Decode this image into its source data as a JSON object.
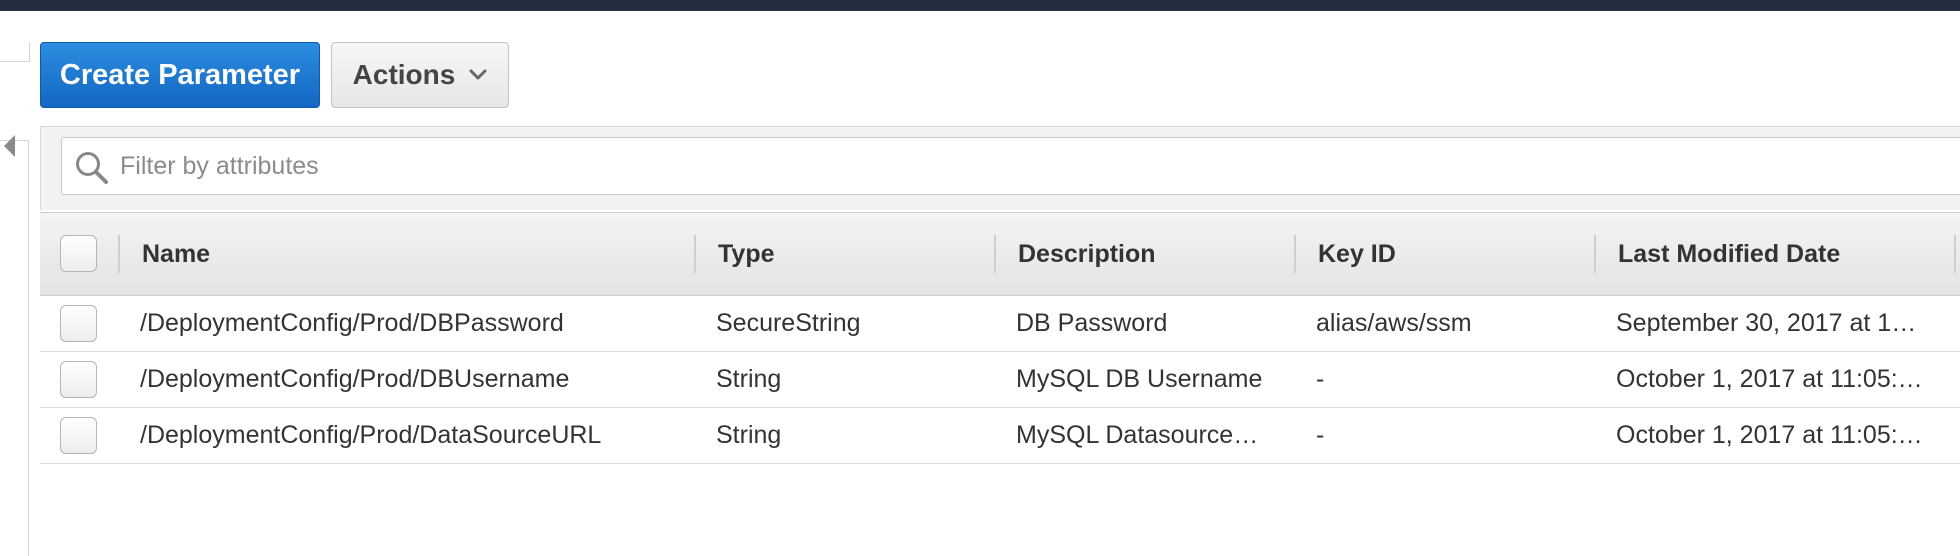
{
  "toolbar": {
    "create_label": "Create Parameter",
    "actions_label": "Actions"
  },
  "filter": {
    "placeholder": "Filter by attributes",
    "value": ""
  },
  "table": {
    "columns": [
      "Name",
      "Type",
      "Description",
      "Key ID",
      "Last Modified Date"
    ],
    "rows": [
      {
        "name": "/DeploymentConfig/Prod/DBPassword",
        "type": "SecureString",
        "description": "DB Password",
        "key_id": "alias/aws/ssm",
        "last_modified": "September 30, 2017 at 1…"
      },
      {
        "name": "/DeploymentConfig/Prod/DBUsername",
        "type": "String",
        "description": "MySQL DB Username",
        "key_id": "-",
        "last_modified": "October 1, 2017 at 11:05:…"
      },
      {
        "name": "/DeploymentConfig/Prod/DataSourceURL",
        "type": "String",
        "description": "MySQL Datasource…",
        "key_id": "-",
        "last_modified": "October 1, 2017 at 11:05:…"
      }
    ]
  },
  "icons": {
    "search": "search-icon",
    "actions_dropdown": "chevron-down-icon",
    "panel_toggle": "caret-left-icon"
  },
  "colors": {
    "primary_button": "#1a72d0",
    "top_bar": "#232f3e"
  }
}
